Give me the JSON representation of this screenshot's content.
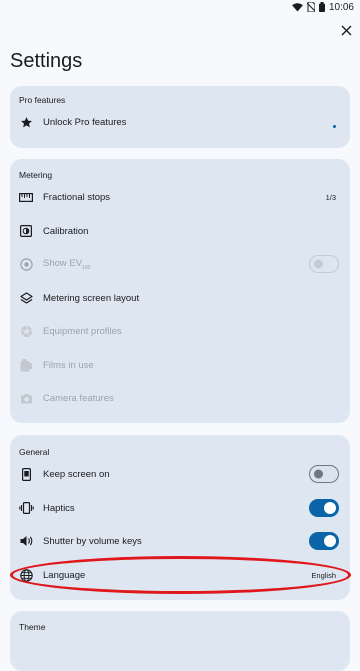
{
  "status_bar": {
    "time": "10:06"
  },
  "page": {
    "title": "Settings"
  },
  "pro": {
    "header": "Pro features",
    "items": [
      {
        "label": "Unlock Pro features",
        "icon": "star-icon"
      }
    ]
  },
  "metering": {
    "header": "Metering",
    "items": [
      {
        "label": "Fractional stops",
        "value": "1/3",
        "icon": "ruler-icon"
      },
      {
        "label": "Calibration",
        "icon": "calibration-icon"
      },
      {
        "label": "Show EV",
        "subscript": "100",
        "icon": "radio-icon",
        "toggle": "disabled-off"
      },
      {
        "label": "Metering screen layout",
        "icon": "layers-icon"
      },
      {
        "label": "Equipment profiles",
        "icon": "aperture-icon",
        "disabled": true
      },
      {
        "label": "Films in use",
        "icon": "film-icon",
        "disabled": true
      },
      {
        "label": "Camera features",
        "icon": "camera-icon",
        "disabled": true
      }
    ]
  },
  "general": {
    "header": "General",
    "items": [
      {
        "label": "Keep screen on",
        "icon": "phone-screen-icon",
        "toggle": "off"
      },
      {
        "label": "Haptics",
        "icon": "vibration-icon",
        "toggle": "on"
      },
      {
        "label": "Shutter by volume keys",
        "icon": "volume-icon",
        "toggle": "on"
      },
      {
        "label": "Language",
        "value": "English",
        "icon": "globe-icon"
      }
    ]
  },
  "theme": {
    "header": "Theme"
  },
  "colors": {
    "accent": "#0a64a8",
    "card": "#dde6f1",
    "annotation": "#e0171b"
  }
}
